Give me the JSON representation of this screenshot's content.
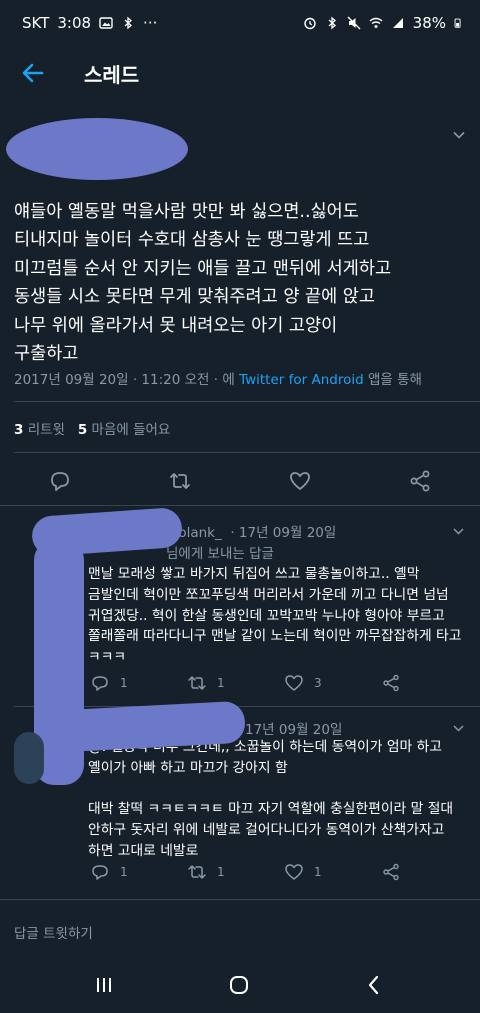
{
  "status_bar": {
    "carrier": "SKT",
    "time": "3:08",
    "more": "···",
    "battery": "38%"
  },
  "header": {
    "title": "스레드"
  },
  "tweet": {
    "lines": [
      "얘들아 옐동말 먹을사람 맛만 봐 싫으면..싫어도",
      "티내지마 놀이터 수호대 삼총사 눈 땡그랗게 뜨고",
      "미끄럼틀 순서 안 지키는 애들 끌고 맨뒤에 서게하고",
      "동생들 시소 못타면 무게 맞춰주려고 양 끝에 앉고",
      "나무 위에 올라가서 못 내려오는 아기 고양이",
      "구출하고"
    ],
    "timestamp": "2017년 09월 20일 · 11:20 오전 · 에 ",
    "source": "Twitter for Android",
    "source_suffix": " 앱을 통해",
    "retweet_count": "3",
    "retweet_label": " 리트윗",
    "like_count": "5",
    "like_label": " 마음에 들어요"
  },
  "replies": [
    {
      "handle_fragment": "o_blank_",
      "date": "· 17년 09월 20일",
      "replying_to": "님에게 보내는 답글",
      "lines": [
        "맨날 모래성 쌓고 바가지 뒤집어 쓰고 물총놀이하고.. 옐막",
        "금발인데 혁이만 쪼꼬푸딩색 머리라서 가운데 끼고 다니면 넘넘",
        "귀엽겠당.. 혁이 한살 동생인데 꼬박꼬박 누나야 형아야 부르고",
        "쫄래쫄래 따라다니구 맨날 같이 노는데 혁이만 까무잡잡하게 타고",
        "ㅋㅋㅋ"
      ],
      "reply_count": "1",
      "retweet_count": "1",
      "like_count": "3"
    },
    {
      "date": "17년 09월 20일",
      "lines": [
        "@. 옐동막 너무 그건데,, 소꿉놀이 하는데 동역이가 엄마 하고",
        "옐이가 아빠 하고 마끄가 강아지 함",
        "",
        "대박 찰떡 ㅋㅋㅌㅋㅋㅌ 마끄 자기 역할에 충실한편이라 말 절대",
        "안하구 돗자리 위에 네발로 걸어다니다가 동역이가 산책가자고",
        "하면 고대로 네발로"
      ],
      "reply_count": "1",
      "retweet_count": "1",
      "like_count": "1"
    }
  ],
  "compose": {
    "placeholder": "답글 트윗하기"
  },
  "colors": {
    "background": "#15202b",
    "accent": "#1da1f2",
    "muted": "#8899a6",
    "divider": "#38444d",
    "redaction": "#6c79c8"
  },
  "icons": [
    "back-arrow-icon",
    "chevron-down-icon",
    "reply-icon",
    "retweet-icon",
    "like-icon",
    "share-icon",
    "recent-apps-icon",
    "home-icon",
    "back-icon"
  ]
}
